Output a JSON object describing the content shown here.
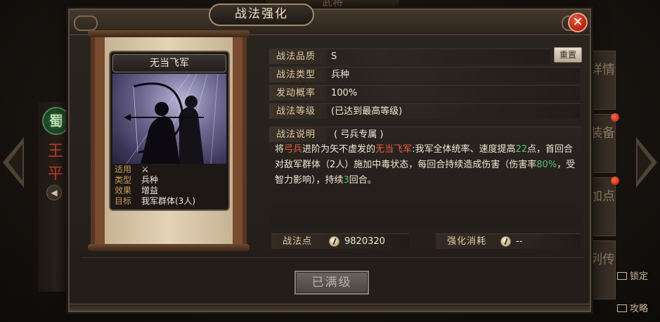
{
  "background": {
    "top_title": "武将",
    "hero_camp": "蜀",
    "hero_name": "王平",
    "right_tabs": [
      "详情",
      "装备",
      "加点",
      "列传"
    ],
    "side_actions": [
      "锁定",
      "攻略"
    ]
  },
  "modal": {
    "title": "战法强化",
    "close_label": "✕",
    "reset_label": "重置",
    "max_button_label": "已满级"
  },
  "card": {
    "name": "无当飞军",
    "info": [
      {
        "key": "适用",
        "value": "⚔"
      },
      {
        "key": "类型",
        "value": "兵种"
      },
      {
        "key": "效果",
        "value": "增益"
      },
      {
        "key": "目标",
        "value": "我军群体(3人)"
      }
    ]
  },
  "fields": {
    "quality": {
      "label": "战法品质",
      "value": "S"
    },
    "type": {
      "label": "战法类型",
      "value": "兵种"
    },
    "rate": {
      "label": "发动概率",
      "value": "100%"
    },
    "level": {
      "label": "战法等级",
      "value": "(已达到最高等级)"
    }
  },
  "description": {
    "label": "战法说明",
    "tag": "( 弓兵专属 )",
    "t1": "将",
    "t2": "弓兵",
    "t3": "进阶为矢不虚发的",
    "t4": "无当飞军",
    "t5": ":我军全体统率、速度提高",
    "t6": "22",
    "t7": "点，首回合对敌军群体（2人）施加中毒状态，每回合持续造成伤害（伤害率",
    "t8": "80%",
    "t9": "，受智力影响），持续",
    "t10": "3",
    "t11": "回合。"
  },
  "points": {
    "label": "战法点",
    "value": "9820320"
  },
  "cost": {
    "label": "强化消耗",
    "value": "--"
  },
  "colors": {
    "highlight_red": "#e8603e",
    "highlight_green": "#52c46f",
    "close_red": "#d33a1f"
  }
}
